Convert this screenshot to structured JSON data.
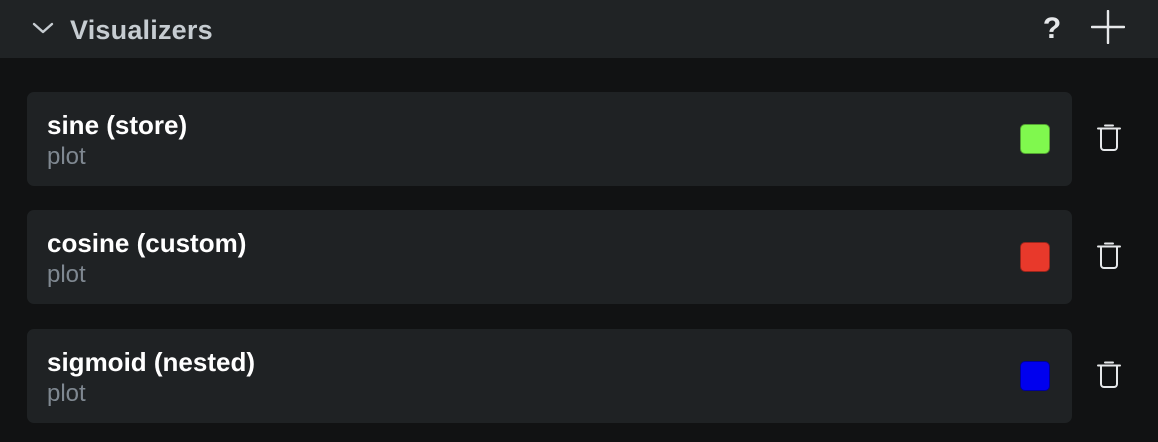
{
  "header": {
    "title": "Visualizers",
    "help_label": "?",
    "collapse_icon": "chevron-down-icon",
    "add_icon": "plus-icon"
  },
  "visualizers": [
    {
      "name": "sine (store)",
      "type": "plot",
      "color": "#80f84e"
    },
    {
      "name": "cosine (custom)",
      "type": "plot",
      "color": "#e8392b"
    },
    {
      "name": "sigmoid (nested)",
      "type": "plot",
      "color": "#0000ee"
    }
  ],
  "row_action_icon": "trash-icon",
  "colors": {
    "header_bg": "#202325",
    "panel_bg": "#111213",
    "card_bg": "#1f2224",
    "title_text": "#c6ccd1",
    "secondary_text": "#7f8891"
  }
}
